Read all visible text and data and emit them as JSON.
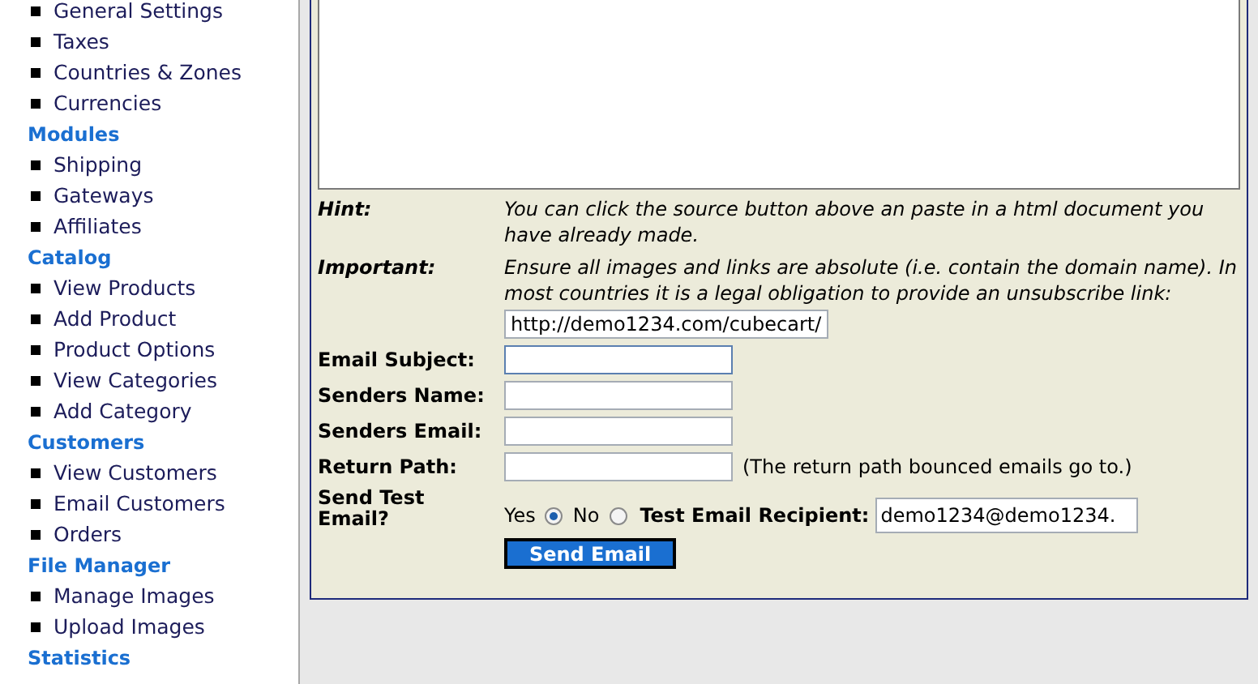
{
  "sidebar": {
    "items": [
      {
        "kind": "link",
        "label": "General Settings"
      },
      {
        "kind": "link",
        "label": "Taxes"
      },
      {
        "kind": "link",
        "label": "Countries & Zones"
      },
      {
        "kind": "link",
        "label": "Currencies"
      },
      {
        "kind": "heading",
        "label": "Modules"
      },
      {
        "kind": "link",
        "label": "Shipping"
      },
      {
        "kind": "link",
        "label": "Gateways"
      },
      {
        "kind": "link",
        "label": "Affiliates"
      },
      {
        "kind": "heading",
        "label": "Catalog"
      },
      {
        "kind": "link",
        "label": "View Products"
      },
      {
        "kind": "link",
        "label": "Add Product"
      },
      {
        "kind": "link",
        "label": "Product Options"
      },
      {
        "kind": "link",
        "label": "View Categories"
      },
      {
        "kind": "link",
        "label": "Add Category"
      },
      {
        "kind": "heading",
        "label": "Customers"
      },
      {
        "kind": "link",
        "label": "View Customers"
      },
      {
        "kind": "link",
        "label": "Email Customers"
      },
      {
        "kind": "link",
        "label": "Orders"
      },
      {
        "kind": "heading",
        "label": "File Manager"
      },
      {
        "kind": "link",
        "label": "Manage Images"
      },
      {
        "kind": "link",
        "label": "Upload Images"
      },
      {
        "kind": "heading",
        "label": "Statistics"
      }
    ]
  },
  "form": {
    "notes": [
      {
        "label": "Hint:",
        "text": "You can click the source button above an paste in a html document you have already made."
      },
      {
        "label": "Important:",
        "text": "Ensure all images and links are absolute (i.e. contain the domain name). In most countries it is a legal obligation to provide an unsubscribe link:",
        "value": "http://demo1234.com/cubecart/"
      }
    ],
    "fields": [
      {
        "label": "Email Subject:",
        "focused": true
      },
      {
        "label": "Senders Name:",
        "focused": false
      },
      {
        "label": "Senders Email:",
        "focused": false
      },
      {
        "label": "Return Path:",
        "focused": false,
        "note": "(The return path bounced emails go to.)"
      }
    ],
    "test": {
      "label": "Send Test Email?",
      "options": [
        {
          "label": "Yes",
          "selected": true
        },
        {
          "label": "No",
          "selected": false
        }
      ],
      "recipient_label": "Test Email Recipient:",
      "recipient_value": "demo1234@demo1234."
    },
    "button": "Send Email"
  }
}
